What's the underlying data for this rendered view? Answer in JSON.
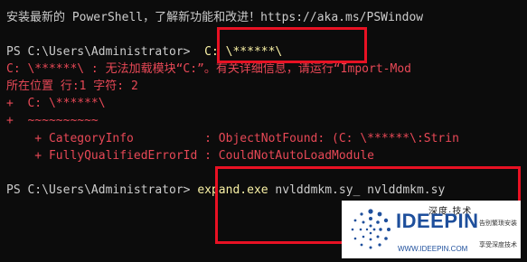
{
  "terminal": {
    "banner": "安装最新的 PowerShell，了解新功能和改进！https://aka.ms/PSWindow",
    "prompt1": "PS C:\\Users\\Administrator> ",
    "command1": " C: \\******\\",
    "error_line1": "C: \\******\\ : 无法加载模块“C:”。有关详细信息，请运行“Import-Mod",
    "error_line2": "所在位置 行:1 字符: 2",
    "error_line3": "+  C: \\******\\",
    "error_line4": "+  ~~~~~~~~~~",
    "error_line5": "    + CategoryInfo          : ObjectNotFound: (C: \\******\\:Strin",
    "error_line6": "    + FullyQualifiedErrorId : CouldNotAutoLoadModule",
    "prompt2": "PS C:\\Users\\Administrator> ",
    "command2_cmd": "expand.exe",
    "command2_args": " nvlddmkm.sy_ nvlddmkm.sy"
  },
  "watermark": {
    "top_text": "深度·技术",
    "brand": "IDEEPIN",
    "url": "WWW.IDEEPIN.COM",
    "tag1": "告别繁琐安装",
    "tag2": "享受深度技术"
  },
  "colors": {
    "background": "#0c0c0c",
    "text": "#cccccc",
    "error": "#e74856",
    "command": "#f9f1a5",
    "highlight_box": "#e81123",
    "watermark_brand": "#1e4f9c"
  }
}
